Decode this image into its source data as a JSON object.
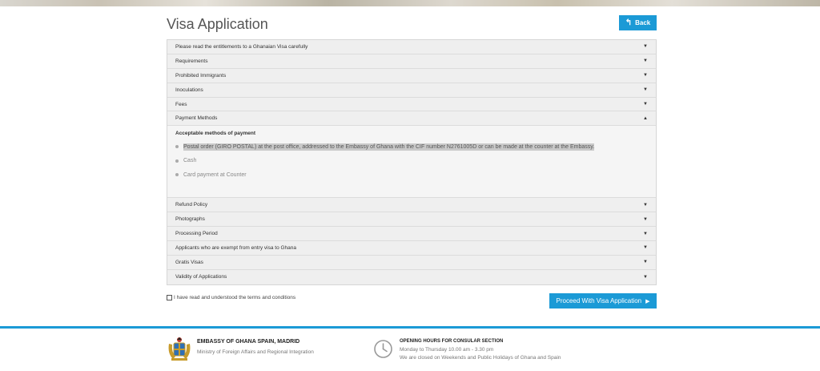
{
  "page": {
    "title": "Visa Application",
    "back_label": "Back"
  },
  "accordion": {
    "items_before": [
      "Please read the entitlements to a Ghanaian Visa carefully",
      "Requirements",
      "Prohibited Immigrants",
      "Inoculations",
      "Fees"
    ],
    "open_item": {
      "label": "Payment Methods",
      "panel_title": "Acceptable methods of payment",
      "methods": [
        "Postal order (GIRO POSTAL) at the post office, addressed to the Embassy of Ghana with the CIF number N2761005D or can be made at the counter at the Embassy.",
        "Cash",
        "Card payment at Counter"
      ]
    },
    "items_after": [
      "Refund Policy",
      "Photographs",
      "Processing Period",
      "Applicants who are exempt from entry visa to Ghana",
      "Gratis Visas",
      "Validity of Applications"
    ],
    "caret_closed": "▼",
    "caret_open": "▲"
  },
  "terms": {
    "label": "I have read and understood the terms and conditions",
    "checked": false
  },
  "proceed_label": "Proceed With Visa Application",
  "footer": {
    "embassy_name": "EMBASSY OF GHANA SPAIN, MADRID",
    "ministry": "Ministry of Foreign Affairs and Regional Integration",
    "hours_title": "OPENING HOURS FOR CONSULAR SECTION",
    "hours_weekday": "Monday to Thursday 10.00 am - 3.30 pm",
    "hours_closed": "We are closed on Weekends and Public Holidays of Ghana and Spain"
  },
  "colors": {
    "accent": "#1b9ad6"
  },
  "icons": {
    "back": "arrow-left-icon",
    "proceed": "triangle-right-icon",
    "crest": "ghana-coat-of-arms-icon",
    "clock": "clock-icon"
  }
}
